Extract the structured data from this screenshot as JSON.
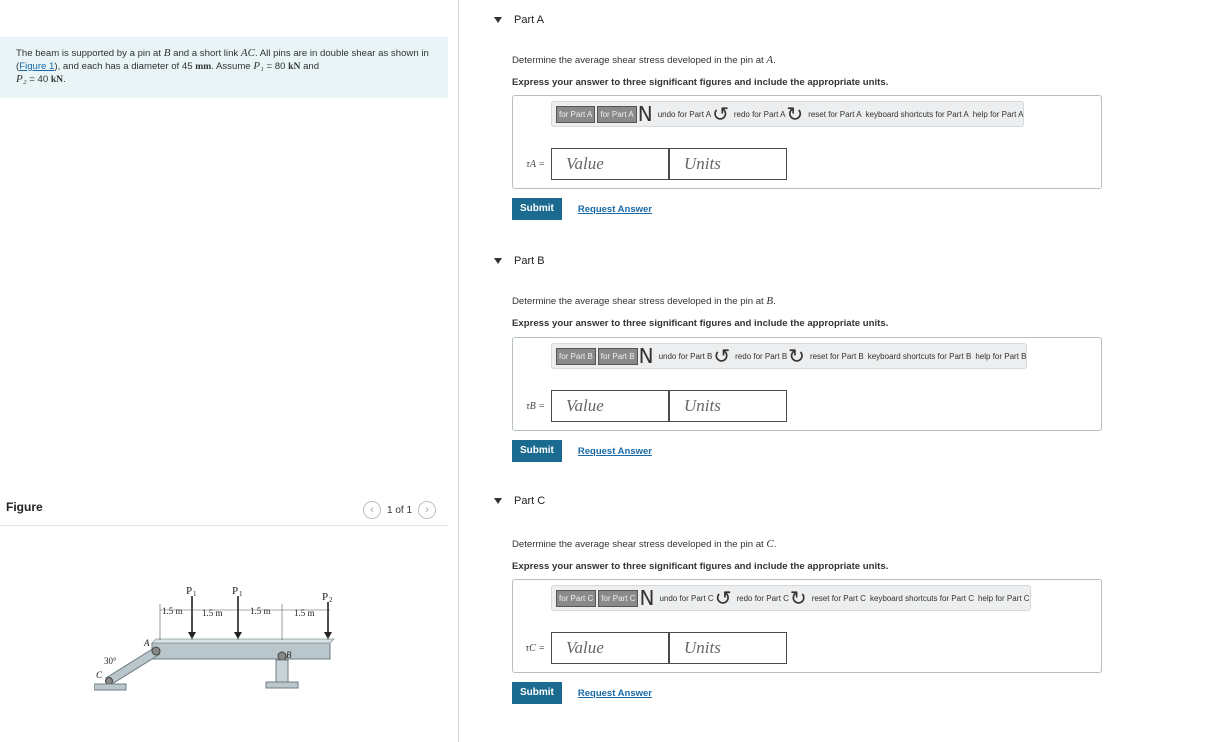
{
  "problem": {
    "text_1": "The beam is supported by a pin at ",
    "B": "B",
    "text_2": " and a short link ",
    "AC": "AC",
    "text_3": ". All pins are in double shear as shown in (",
    "figure_link": "Figure 1",
    "text_4": "), and each has a diameter of 45 ",
    "mm": "mm",
    "text_5": ". Assume ",
    "P1": "P₁",
    "text_6": " = 80 ",
    "kN1": "kN",
    "text_7": " and",
    "P2": "P₂",
    "text_8": " = 40 ",
    "kN2": "kN",
    "text_9": "."
  },
  "figure": {
    "title": "Figure",
    "pager": "1 of 1",
    "labels": {
      "p1a": "P",
      "p1b": "P",
      "p2": "P",
      "sub1": "1",
      "sub2": "2",
      "d1": "1.5 m",
      "d2": "1.5 m",
      "d3": "1.5 m",
      "d4": "1.5 m",
      "angle": "30°",
      "A": "A",
      "B": "B",
      "C": "C"
    }
  },
  "toolbar_items": {
    "templates": "for Part",
    "undo": "undo for Part",
    "redo": "redo for Part",
    "reset": "reset for Part",
    "keyboard": "keyboard shortcuts for Part",
    "help": "help for Part"
  },
  "parts": [
    {
      "title": "Part A",
      "q1": "Determine the average shear stress developed in the pin at ",
      "point": "A",
      "q2": "Express your answer to three significant figures and include the appropriate units.",
      "tau_label": "τA =",
      "value_placeholder": "Value",
      "units_placeholder": "Units",
      "submit": "Submit",
      "request": "Request Answer",
      "tb": [
        "for Part A",
        "for Part A",
        "undo for Part A",
        "redo for Part A",
        "reset for Part A",
        "keyboard shortcuts for Part A",
        "help for Part A"
      ]
    },
    {
      "title": "Part B",
      "q1": "Determine the average shear stress developed in the pin at ",
      "point": "B",
      "q2": "Express your answer to three significant figures and include the appropriate units.",
      "tau_label": "τB =",
      "value_placeholder": "Value",
      "units_placeholder": "Units",
      "submit": "Submit",
      "request": "Request Answer",
      "tb": [
        "for Part B",
        "for Part B",
        "undo for Part B",
        "redo for Part B",
        "reset for Part B",
        "keyboard shortcuts for Part B",
        "help for Part B"
      ]
    },
    {
      "title": "Part C",
      "q1": "Determine the average shear stress developed in the pin at ",
      "point": "C",
      "q2": "Express your answer to three significant figures and include the appropriate units.",
      "tau_label": "τC =",
      "value_placeholder": "Value",
      "units_placeholder": "Units",
      "submit": "Submit",
      "request": "Request Answer",
      "tb": [
        "for Part C",
        "for Part C",
        "undo for Part C",
        "redo for Part C",
        "reset for Part C",
        "keyboard shortcuts for Part C",
        "help for Part C"
      ]
    }
  ]
}
